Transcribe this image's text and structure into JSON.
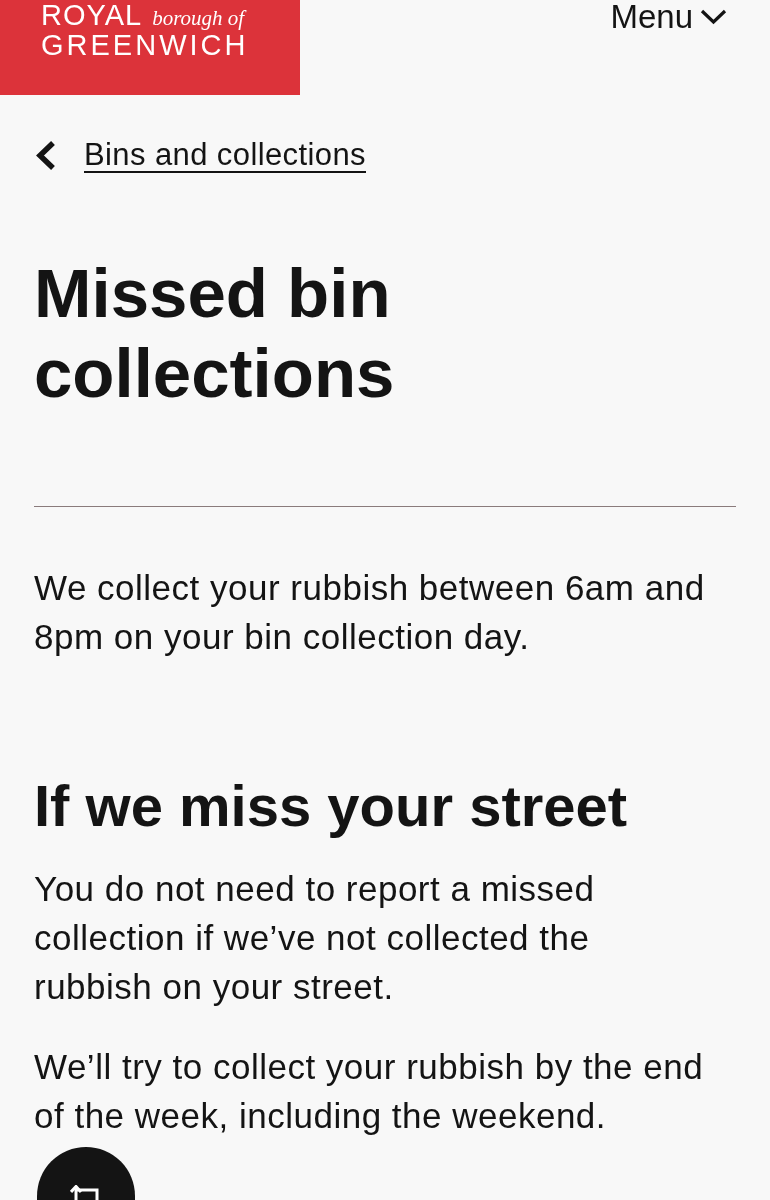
{
  "header": {
    "logo": {
      "line_1": "ROYAL",
      "line_2": "borough of",
      "line_3": "GREENWICH"
    },
    "menu_button": {
      "label": "Menu"
    }
  },
  "breadcrumb": {
    "label": "Bins and collections"
  },
  "title": "Missed bin collections",
  "intro": "We collect your rubbish between 6am and 8pm on your bin collection day.",
  "sections": [
    {
      "heading": "If we miss your street",
      "paragraphs": [
        "You do not need to report a missed collection if we’ve not collected the rubbish on your street.",
        "We’ll try to collect your rubbish by the end of the week, including the weekend."
      ]
    }
  ]
}
